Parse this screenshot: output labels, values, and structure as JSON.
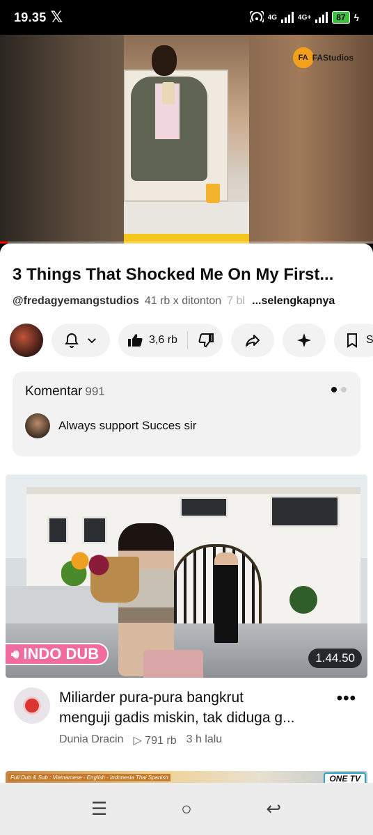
{
  "status_bar": {
    "time": "19.35",
    "social_icon": "x-logo",
    "network_1": "4G",
    "network_2": "4G+",
    "battery": "87"
  },
  "video": {
    "channel_logo_text": "FAStudios",
    "progress_fraction": 0.02
  },
  "details": {
    "title": "3 Things That Shocked Me On My First...",
    "channel_handle": "@fredagyemangstudios",
    "views": "41 rb x ditonton",
    "time_ago": "7 bl",
    "more_link": "...selengkapnya"
  },
  "actions": {
    "like_count": "3,6 rb",
    "save_label": "S"
  },
  "comments": {
    "label": "Komentar",
    "count": "991",
    "top_comment": "Always support Succes sir"
  },
  "recommended": {
    "badge": "INDO DUB",
    "duration": "1.44.50",
    "title_line1": "Miliarder pura-pura bangkrut",
    "title_line2": "menguji gadis miskin, tak diduga g...",
    "channel": "Dunia Dracin",
    "views": "791 rb",
    "time_ago": "3 h lalu",
    "channel_avatar_text": "Dunia Dracin"
  },
  "next_thumbnail": {
    "subtitle_text": "Full Dub & Sub : Vietnamese - English - Indonesia Thai Spanish",
    "logo_text": "ONE TV"
  },
  "colors": {
    "accent": "#ff0000",
    "pill_bg": "#f2f2f2",
    "dub_badge": "#f06ca0",
    "battery": "#3ec03e"
  }
}
